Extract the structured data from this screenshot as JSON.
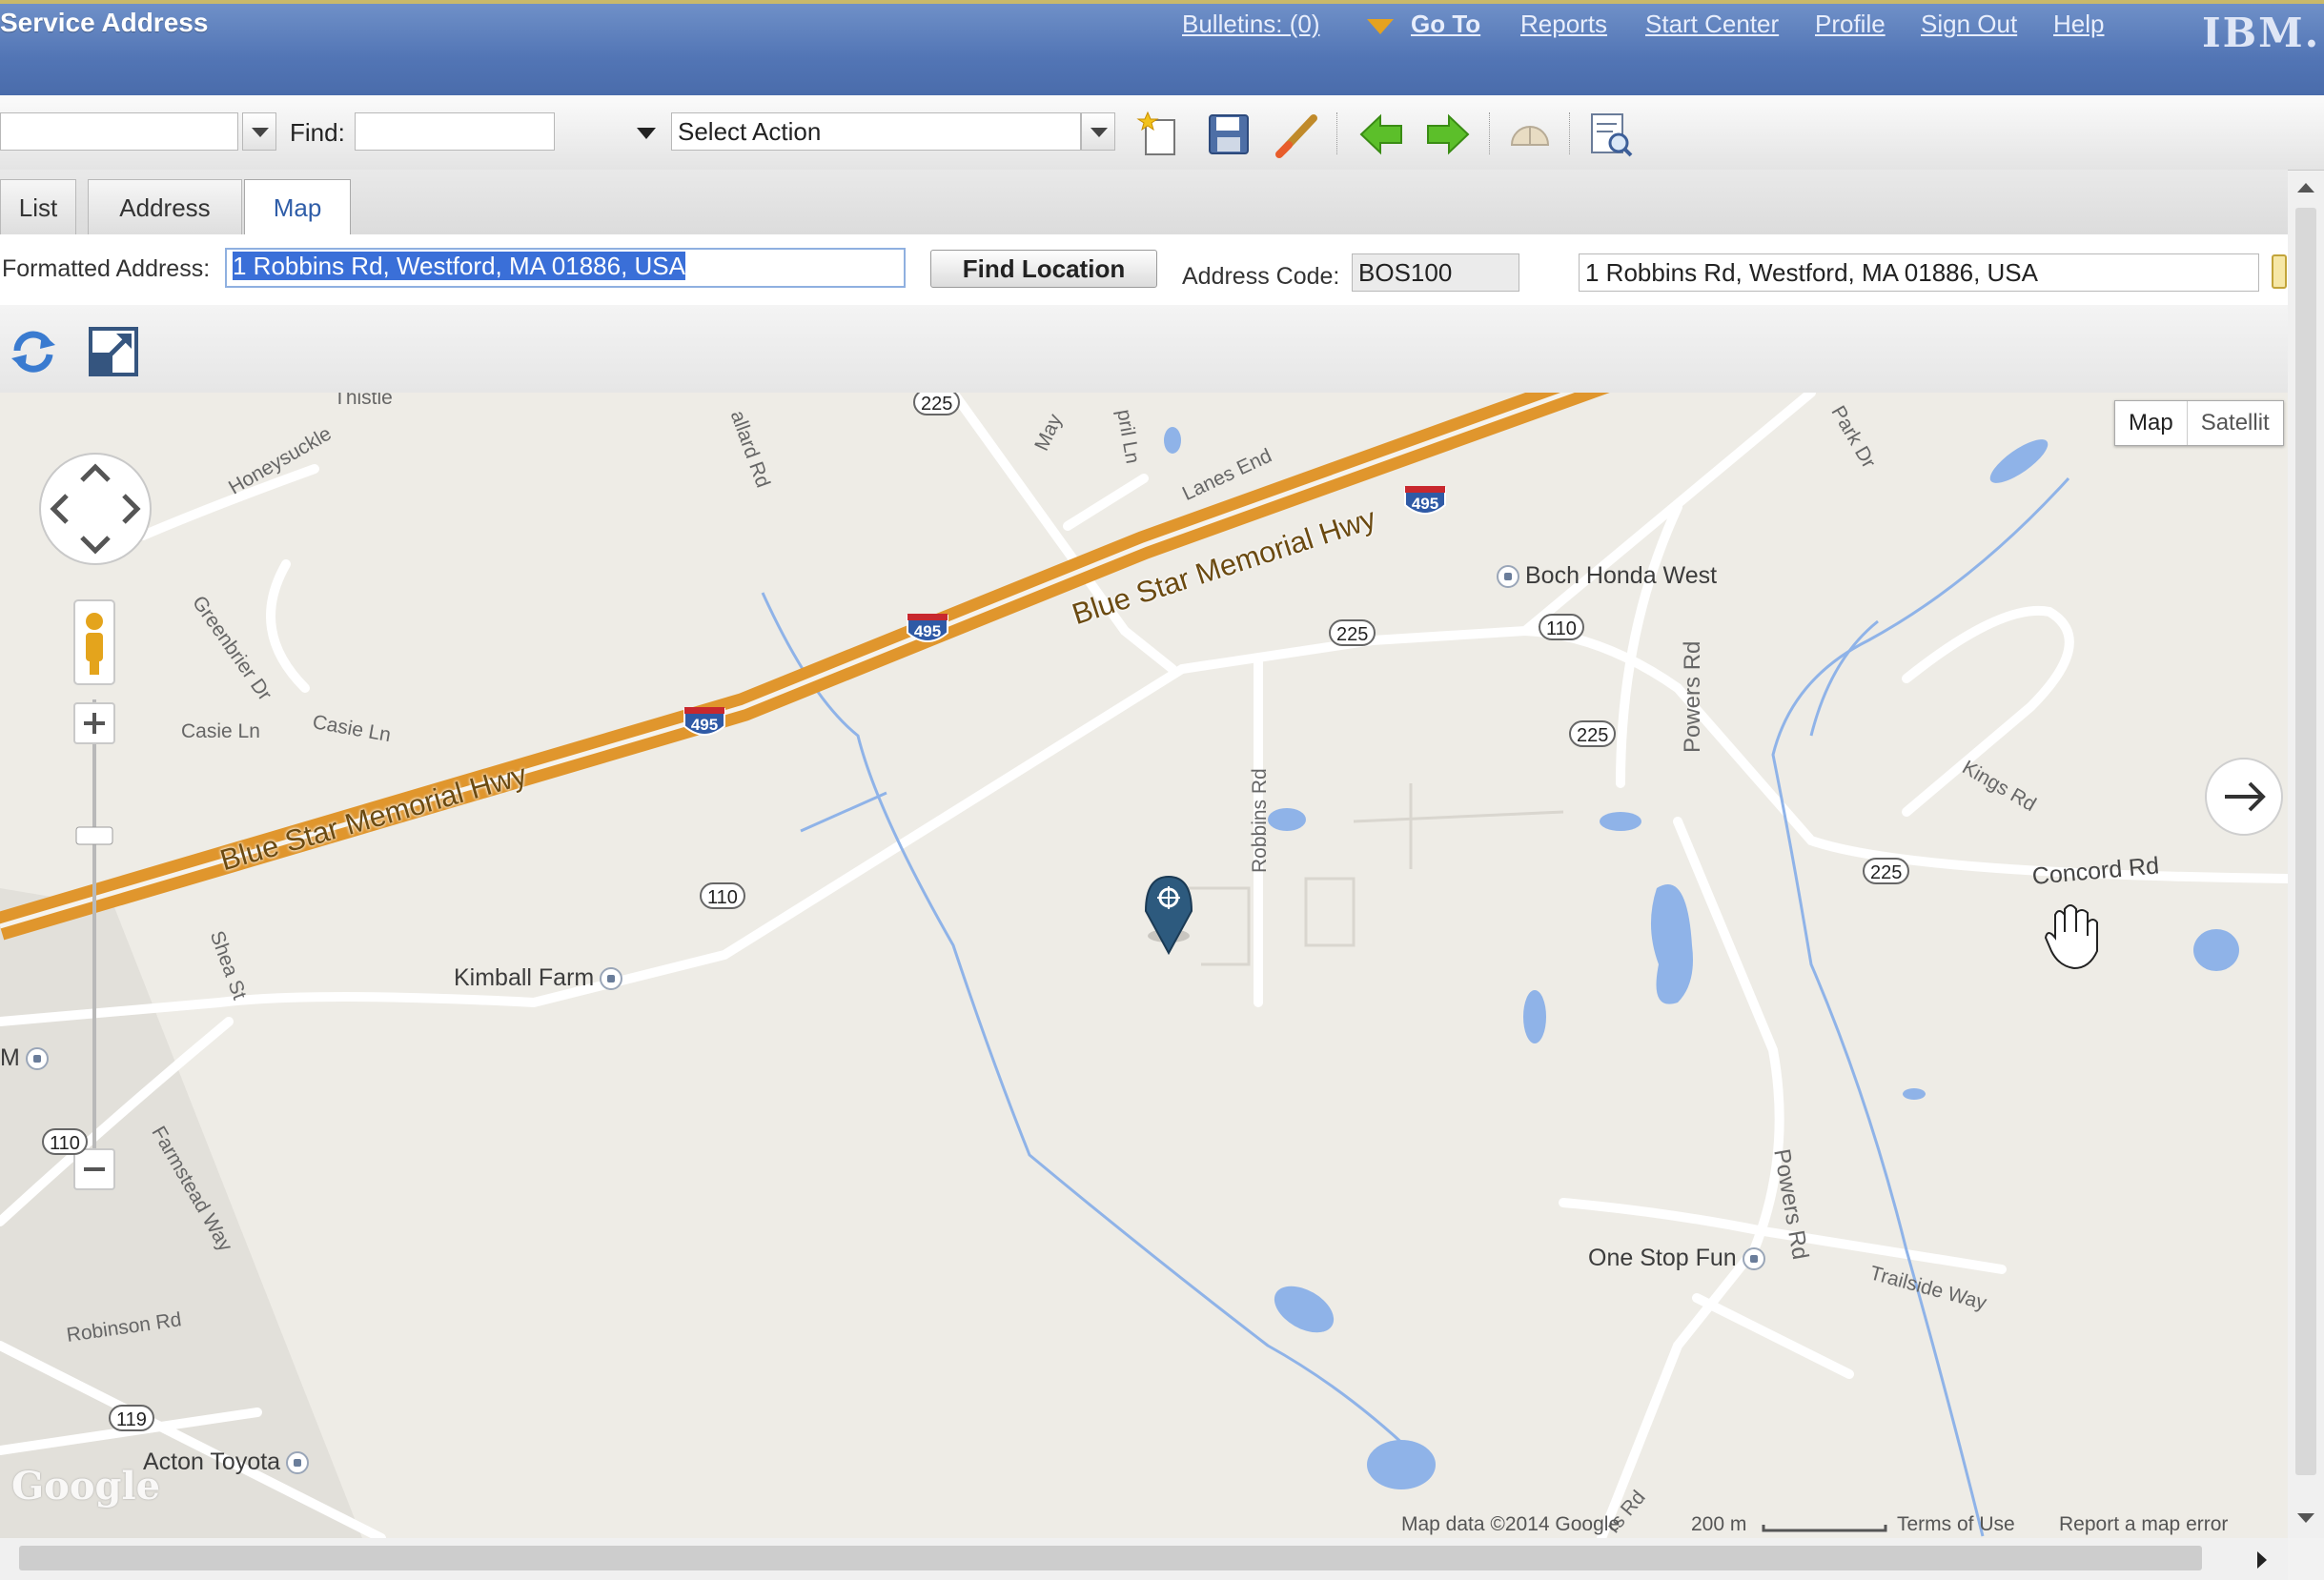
{
  "header": {
    "title": "Service Address",
    "links": [
      {
        "label": "Bulletins: (0)"
      },
      {
        "label": "Go To"
      },
      {
        "label": "Reports"
      },
      {
        "label": "Start Center"
      },
      {
        "label": "Profile"
      },
      {
        "label": "Sign Out"
      },
      {
        "label": "Help"
      }
    ],
    "logo": "IBM."
  },
  "toolbar": {
    "find_label": "Find:",
    "find_value": "",
    "action_select": "Select Action",
    "icons": [
      "new-record-icon",
      "save-icon",
      "clear-changes-icon",
      "previous-record-icon",
      "next-record-icon",
      "route-workflow-icon",
      "view-details-icon"
    ]
  },
  "tabs": [
    {
      "label": "List",
      "active": false
    },
    {
      "label": "Address",
      "active": false
    },
    {
      "label": "Map",
      "active": true
    }
  ],
  "address_row": {
    "formatted_label": "Formatted Address:",
    "formatted_value": "1 Robbins Rd, Westford, MA 01886, USA",
    "find_location": "Find Location",
    "code_label": "Address Code:",
    "code_value": "BOS100",
    "description_value": "1 Robbins Rd, Westford, MA 01886, USA"
  },
  "map_tools": {
    "icons": [
      "refresh-map-icon",
      "expand-map-icon"
    ]
  },
  "map": {
    "type_buttons": [
      "Map",
      "Satellit"
    ],
    "highway_labels": [
      "Blue Star Memorial Hwy",
      "Blue Star Memorial Hwy"
    ],
    "interstate_shields": [
      "495",
      "495",
      "495"
    ],
    "route_shields": [
      "225",
      "225",
      "225",
      "225",
      "110",
      "110",
      "110",
      "119"
    ],
    "streets": [
      "Honeysuckle",
      "Thistle",
      "allard Rd",
      "May",
      "pril Ln",
      "Lanes End",
      "Park Dr",
      "Greenbrier Dr",
      "Casie Ln",
      "Casie Ln",
      "Robbins Rd",
      "Powers Rd",
      "Powers Rd",
      "Kings Rd",
      "Concord Rd",
      "Shea St",
      "Farmstead Way",
      "Robinson Rd",
      "Trailside Way",
      "rs Rd"
    ],
    "pois": [
      {
        "label": "Boch Honda West"
      },
      {
        "label": "Kimball Farm"
      },
      {
        "label": "One Stop Fun"
      },
      {
        "label": "Acton Toyota"
      }
    ],
    "edge_label": "M",
    "attribution": {
      "google": "Google",
      "map_data": "Map data ©2014 Google",
      "scale": "200 m",
      "terms": "Terms of Use",
      "report": "Report a map error"
    }
  }
}
